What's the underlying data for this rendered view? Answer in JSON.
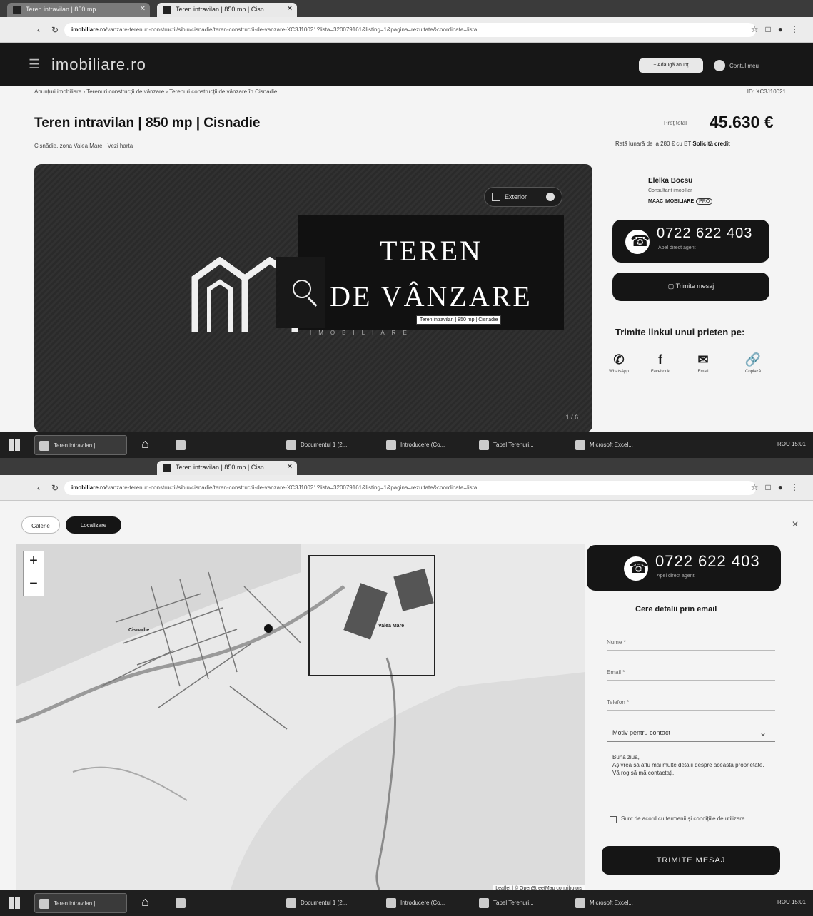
{
  "window1": {
    "tabs": [
      {
        "label": "Teren intravilan | 850 mp...",
        "active": false
      },
      {
        "label": "Teren intravilan | 850 mp | Cisn...",
        "active": true
      }
    ],
    "url_host": "imobiliare.ro",
    "url_path": "/vanzare-terenuri-constructii/sibiu/cisnadie/teren-constructii-de-vanzare-XC3J10021?lista=320079161&listing=1&pagina=rezultate&coordinate=lista"
  },
  "header": {
    "logo": "imobiliare.ro",
    "add_button": "+ Adaugă anunț",
    "user_label": "Contul meu"
  },
  "breadcrumbs": "Anunțuri imobiliare  ›  Terenuri construcții de vânzare  ›  Terenuri construcții de vânzare în Cisnadie",
  "breadcrumb_right": "ID: XC3J10021",
  "listing": {
    "title": "Teren intravilan | 850 mp | Cisnadie",
    "subtitle": "Cisnădie, zona Valea Mare · Vezi harta",
    "price_label": "Preț total",
    "price": "45.630 €",
    "price_note": "Rată lunară de la 280 € cu BT ",
    "price_note_bold": "Solicită credit",
    "photo_ext_label": "Exterior",
    "photo_sign_line1": "TEREN",
    "photo_sign_line2": "DE VÂNZARE",
    "photo_sub": "IMOBILIARE",
    "tooltip": "Teren intravilan | 850 mp | Cisnadie",
    "photo_counter": "1 / 6"
  },
  "agent": {
    "name": "Elelka Bocsu",
    "role": "Consultant imobiliar",
    "agency": "MAAC IMOBILIARE",
    "badge": "PRO",
    "phone": "0722 622 403",
    "phone_hint": "Apel direct agent",
    "message_button": "Trimite mesaj",
    "share_title": "Trimite linkul unui prieten pe:",
    "share": [
      {
        "icon": "whatsapp-icon",
        "glyph": "✆",
        "label": "WhatsApp"
      },
      {
        "icon": "facebook-icon",
        "glyph": "f",
        "label": "Facebook"
      },
      {
        "icon": "email-icon",
        "glyph": "✉",
        "label": "Email"
      },
      {
        "icon": "link-icon",
        "glyph": "🔗",
        "label": "Copiază"
      }
    ]
  },
  "taskbar": {
    "items": [
      "Teren intravilan |...",
      "Documentul 1 (2...",
      "Introducere (Co...",
      "Tabel Terenuri...",
      "Microsoft Excel..."
    ],
    "clock": "ROU 15:01"
  },
  "window2": {
    "tab_label": "Teren intravilan | 850 mp | Cisn...",
    "url_host": "imobiliare.ro",
    "url_path": "/vanzare-terenuri-constructii/sibiu/cisnadie/teren-constructii-de-vanzare-XC3J10021?lista=320079161&listing=1&pagina=rezultate&coordinate=lista"
  },
  "map_view": {
    "tab_photos": "Galerie",
    "tab_map": "Localizare",
    "zoom_in": "+",
    "zoom_out": "−",
    "labels": [
      "Cisnadie",
      "Valea Mare"
    ],
    "attribution": "Leaflet | © OpenStreetMap contributors"
  },
  "contact_form": {
    "phone": "0722 622 403",
    "phone_hint": "Apel direct agent",
    "title": "Cere detalii prin email",
    "fields": [
      "Nume *",
      "Email *",
      "Telefon *"
    ],
    "select_value": "Motiv pentru contact",
    "message_line1": "Bună ziua,",
    "message_line2": "Aș vrea să aflu mai multe detalii despre această proprietate. Vă rog să mă contactați.",
    "checkbox_label": "Sunt de acord cu termenii și condițiile de utilizare",
    "submit": "TRIMITE MESAJ"
  },
  "colors": {
    "dark": "#151515",
    "accent": "#111111"
  }
}
